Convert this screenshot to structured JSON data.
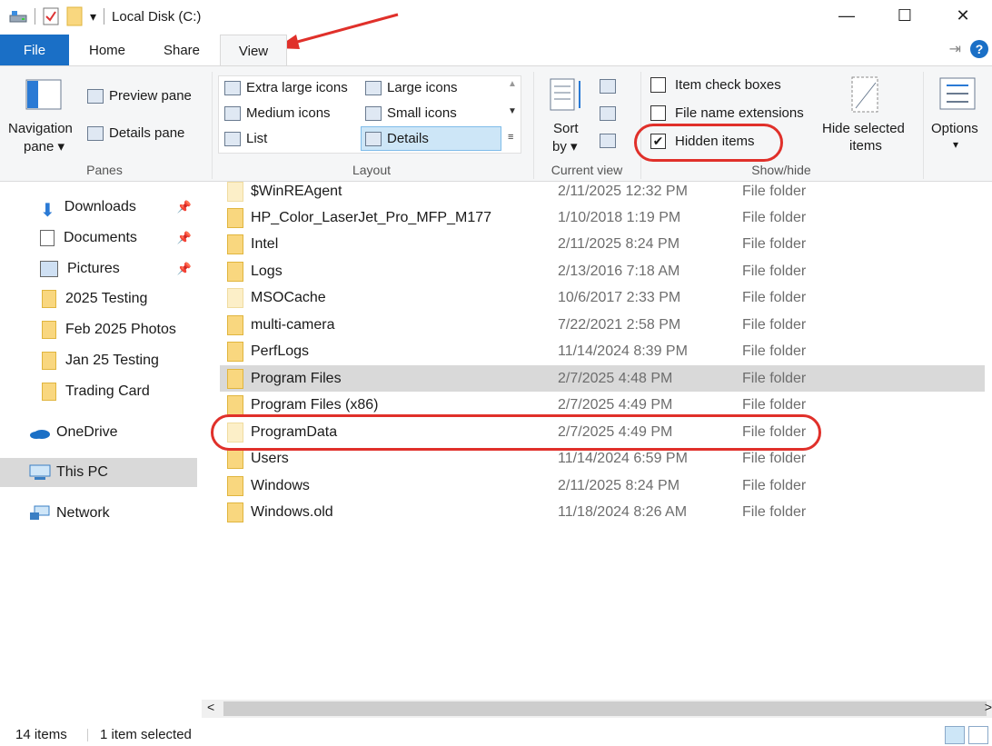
{
  "window": {
    "title": "Local Disk (C:)",
    "minimize_glyph": "—",
    "maximize_glyph": "☐",
    "close_glyph": "✕",
    "qat_dropdown_glyph": "▾"
  },
  "tabs": {
    "file": "File",
    "home": "Home",
    "share": "Share",
    "view": "View",
    "pin_glyph": "⇥",
    "help_glyph": "?"
  },
  "ribbon": {
    "panes": {
      "navigation_line1": "Navigation",
      "navigation_line2": "pane ▾",
      "preview": "Preview pane",
      "details": "Details pane",
      "label": "Panes"
    },
    "layout": {
      "extra_large": "Extra large icons",
      "large": "Large icons",
      "medium": "Medium icons",
      "small": "Small icons",
      "list": "List",
      "details": "Details",
      "label": "Layout"
    },
    "current_view": {
      "sort_line1": "Sort",
      "sort_line2": "by ▾",
      "label": "Current view"
    },
    "show_hide": {
      "item_check_boxes": "Item check boxes",
      "file_name_extensions": "File name extensions",
      "hidden_items": "Hidden items",
      "hidden_items_check": "✔",
      "hide_selected_line1": "Hide selected",
      "hide_selected_line2": "items",
      "label": "Show/hide"
    },
    "options": {
      "label": "Options",
      "dropdown_glyph": "▾"
    }
  },
  "nav": {
    "pin_glyph": "📌",
    "items": [
      {
        "label": "Downloads",
        "pinned": true
      },
      {
        "label": "Documents",
        "pinned": true
      },
      {
        "label": "Pictures",
        "pinned": true
      },
      {
        "label": "2025 Testing",
        "pinned": false
      },
      {
        "label": "Feb 2025 Photos",
        "pinned": false
      },
      {
        "label": "Jan 25 Testing",
        "pinned": false
      },
      {
        "label": "Trading Card",
        "pinned": false
      },
      {
        "label": "OneDrive",
        "pinned": false
      },
      {
        "label": "This PC",
        "pinned": false
      },
      {
        "label": "Network",
        "pinned": false
      }
    ]
  },
  "files": [
    {
      "name": "$WinREAgent",
      "date": "2/11/2025 12:32 PM",
      "type": "File folder",
      "hidden": true
    },
    {
      "name": "HP_Color_LaserJet_Pro_MFP_M177",
      "date": "1/10/2018 1:19 PM",
      "type": "File folder",
      "hidden": false
    },
    {
      "name": "Intel",
      "date": "2/11/2025 8:24 PM",
      "type": "File folder",
      "hidden": false
    },
    {
      "name": "Logs",
      "date": "2/13/2016 7:18 AM",
      "type": "File folder",
      "hidden": false
    },
    {
      "name": "MSOCache",
      "date": "10/6/2017 2:33 PM",
      "type": "File folder",
      "hidden": true
    },
    {
      "name": "multi-camera",
      "date": "7/22/2021 2:58 PM",
      "type": "File folder",
      "hidden": false
    },
    {
      "name": "PerfLogs",
      "date": "11/14/2024 8:39 PM",
      "type": "File folder",
      "hidden": false
    },
    {
      "name": "Program Files",
      "date": "2/7/2025 4:48 PM",
      "type": "File folder",
      "hidden": false
    },
    {
      "name": "Program Files (x86)",
      "date": "2/7/2025 4:49 PM",
      "type": "File folder",
      "hidden": false
    },
    {
      "name": "ProgramData",
      "date": "2/7/2025 4:49 PM",
      "type": "File folder",
      "hidden": true
    },
    {
      "name": "Users",
      "date": "11/14/2024 6:59 PM",
      "type": "File folder",
      "hidden": false
    },
    {
      "name": "Windows",
      "date": "2/11/2025 8:24 PM",
      "type": "File folder",
      "hidden": false
    },
    {
      "name": "Windows.old",
      "date": "11/18/2024 8:26 AM",
      "type": "File folder",
      "hidden": false
    }
  ],
  "scroll": {
    "left_glyph": "<",
    "right_glyph": ">"
  },
  "status": {
    "item_count": "14 items",
    "selection": "1 item selected"
  },
  "colors": {
    "file_tab": "#1a6fc6",
    "annotation_red": "#e0302a",
    "selection": "#d9d9d9"
  }
}
